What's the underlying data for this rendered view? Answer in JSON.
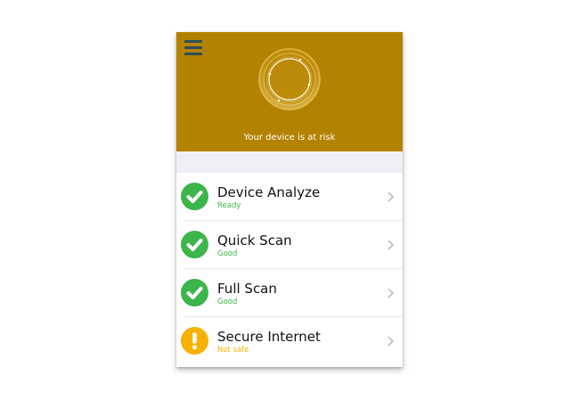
{
  "header": {
    "status_text": "Your device is at risk",
    "background_color": "#b38200",
    "menu_icon": "hamburger-menu-icon",
    "status_graphic": "scan-ring-icon"
  },
  "items": [
    {
      "title": "Device Analyze",
      "status": "Ready",
      "state": "ok",
      "icon": "check-circle-icon",
      "status_color": "#3cb54a"
    },
    {
      "title": "Quick Scan",
      "status": "Good",
      "state": "ok",
      "icon": "check-circle-icon",
      "status_color": "#3cb54a"
    },
    {
      "title": "Full Scan",
      "status": "Good",
      "state": "ok",
      "icon": "check-circle-icon",
      "status_color": "#3cb54a"
    },
    {
      "title": "Secure Internet",
      "status": "Not safe",
      "state": "warning",
      "icon": "exclamation-circle-icon",
      "status_color": "#f7b100"
    }
  ],
  "colors": {
    "ok": "#3cb54a",
    "warning": "#f7b100",
    "chevron": "#b5b5bb"
  }
}
